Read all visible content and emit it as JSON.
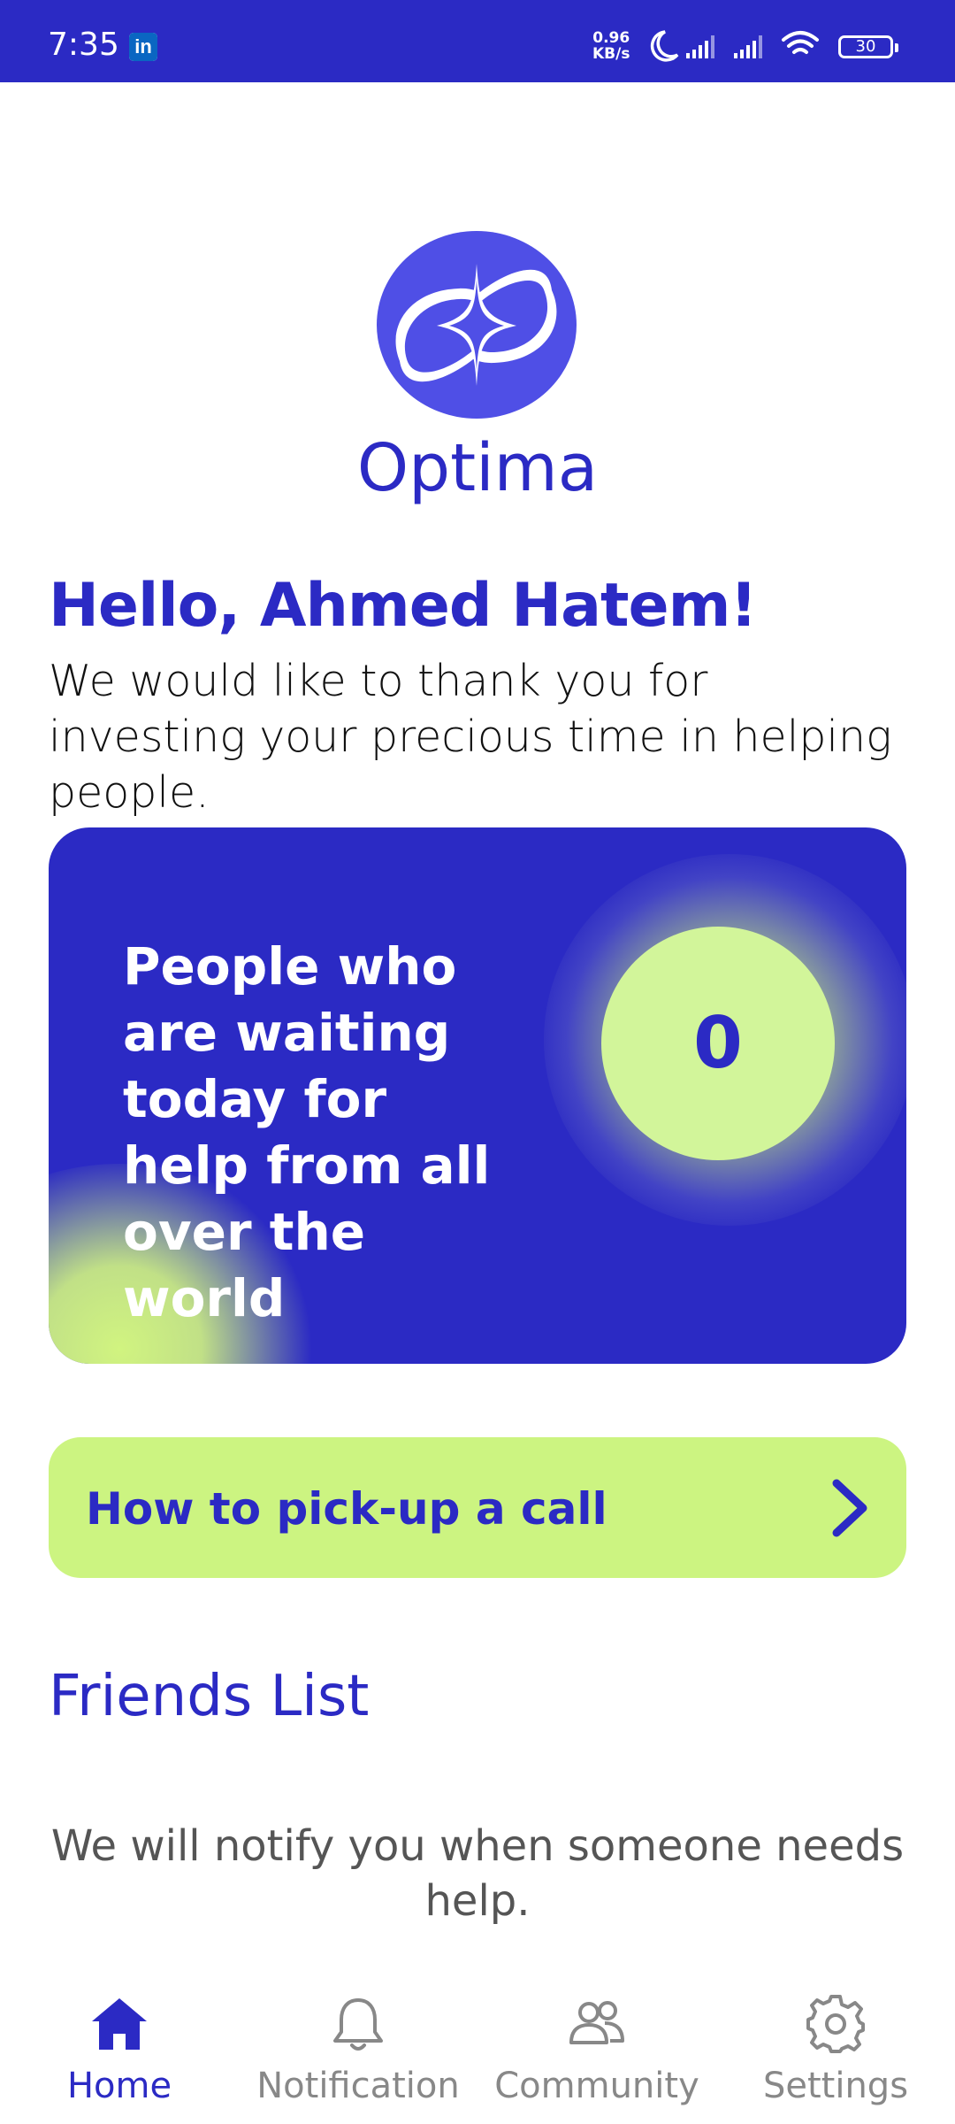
{
  "status_bar": {
    "time": "7:35",
    "app_badge": "in",
    "net_speed_value": "0.96",
    "net_speed_unit": "KB/s",
    "battery": "30"
  },
  "brand": {
    "name": "Optima",
    "color": "#2b2ac4",
    "logo_icon": "optima-logo-icon"
  },
  "greeting": {
    "title": "Hello, Ahmed Hatem!",
    "text": "We would like to thank you for investing your precious time in helping people."
  },
  "waiting_card": {
    "text": "People who are waiting today for help from all over the world",
    "count": "0",
    "accent": "#d2f59a"
  },
  "pickup_button": {
    "label": "How to pick-up a call",
    "icon": "chevron-right-icon"
  },
  "friends": {
    "title": "Friends List",
    "empty_message": "We will notify you when someone needs help."
  },
  "nav": {
    "items": [
      {
        "label": "Home",
        "icon": "home-icon",
        "active": true
      },
      {
        "label": "Notification",
        "icon": "bell-icon",
        "active": false
      },
      {
        "label": "Community",
        "icon": "people-icon",
        "active": false
      },
      {
        "label": "Settings",
        "icon": "gear-icon",
        "active": false
      }
    ]
  }
}
